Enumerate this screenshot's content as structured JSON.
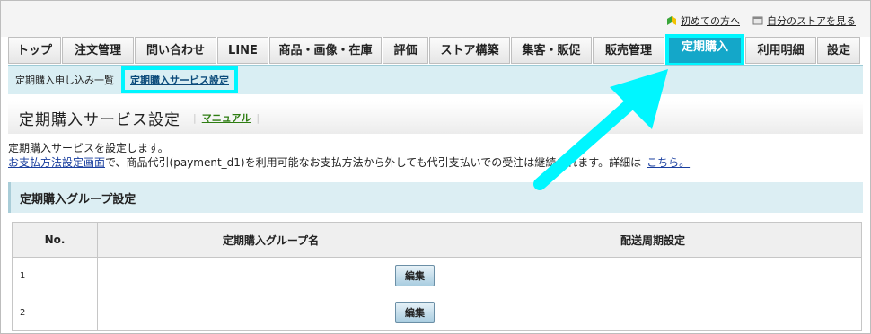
{
  "toplinks": [
    {
      "label": "初めての方へ",
      "icon": "beginner-icon"
    },
    {
      "label": "自分のストアを見る",
      "icon": "store-icon"
    }
  ],
  "tabs": [
    {
      "label": "トップ",
      "active": false
    },
    {
      "label": "注文管理",
      "active": false
    },
    {
      "label": "問い合わせ",
      "active": false
    },
    {
      "label": "LINE",
      "active": false
    },
    {
      "label": "商品・画像・在庫",
      "active": false
    },
    {
      "label": "評価",
      "active": false
    },
    {
      "label": "ストア構築",
      "active": false
    },
    {
      "label": "集客・販促",
      "active": false
    },
    {
      "label": "販売管理",
      "active": false
    },
    {
      "label": "定期購入",
      "active": true
    },
    {
      "label": "利用明細",
      "active": false
    },
    {
      "label": "設定",
      "active": false
    }
  ],
  "subnav": {
    "items": [
      {
        "label": "定期購入申し込み一覧"
      },
      {
        "label": "定期購入サービス設定"
      }
    ]
  },
  "page": {
    "title": "定期購入サービス設定",
    "manual": "マニュアル"
  },
  "description": {
    "line1": "定期購入サービスを設定します。",
    "link": "お支払方法設定画面",
    "line2_mid": "で、商品代引(payment_d1)を利用可能なお支払方法から外しても代引支払いでの受注は継続されます。詳細は",
    "more_link": "こちら。"
  },
  "section": {
    "title": "定期購入グループ設定"
  },
  "table": {
    "headers": [
      "No.",
      "定期購入グループ名",
      "配送周期設定"
    ],
    "rows": [
      {
        "no": "1",
        "edit": "編集"
      },
      {
        "no": "2",
        "edit": "編集"
      }
    ]
  },
  "colors": {
    "active_tab": "#14a7c9",
    "highlight": "#00f6ff",
    "subnav_bg": "#d9eef3"
  }
}
